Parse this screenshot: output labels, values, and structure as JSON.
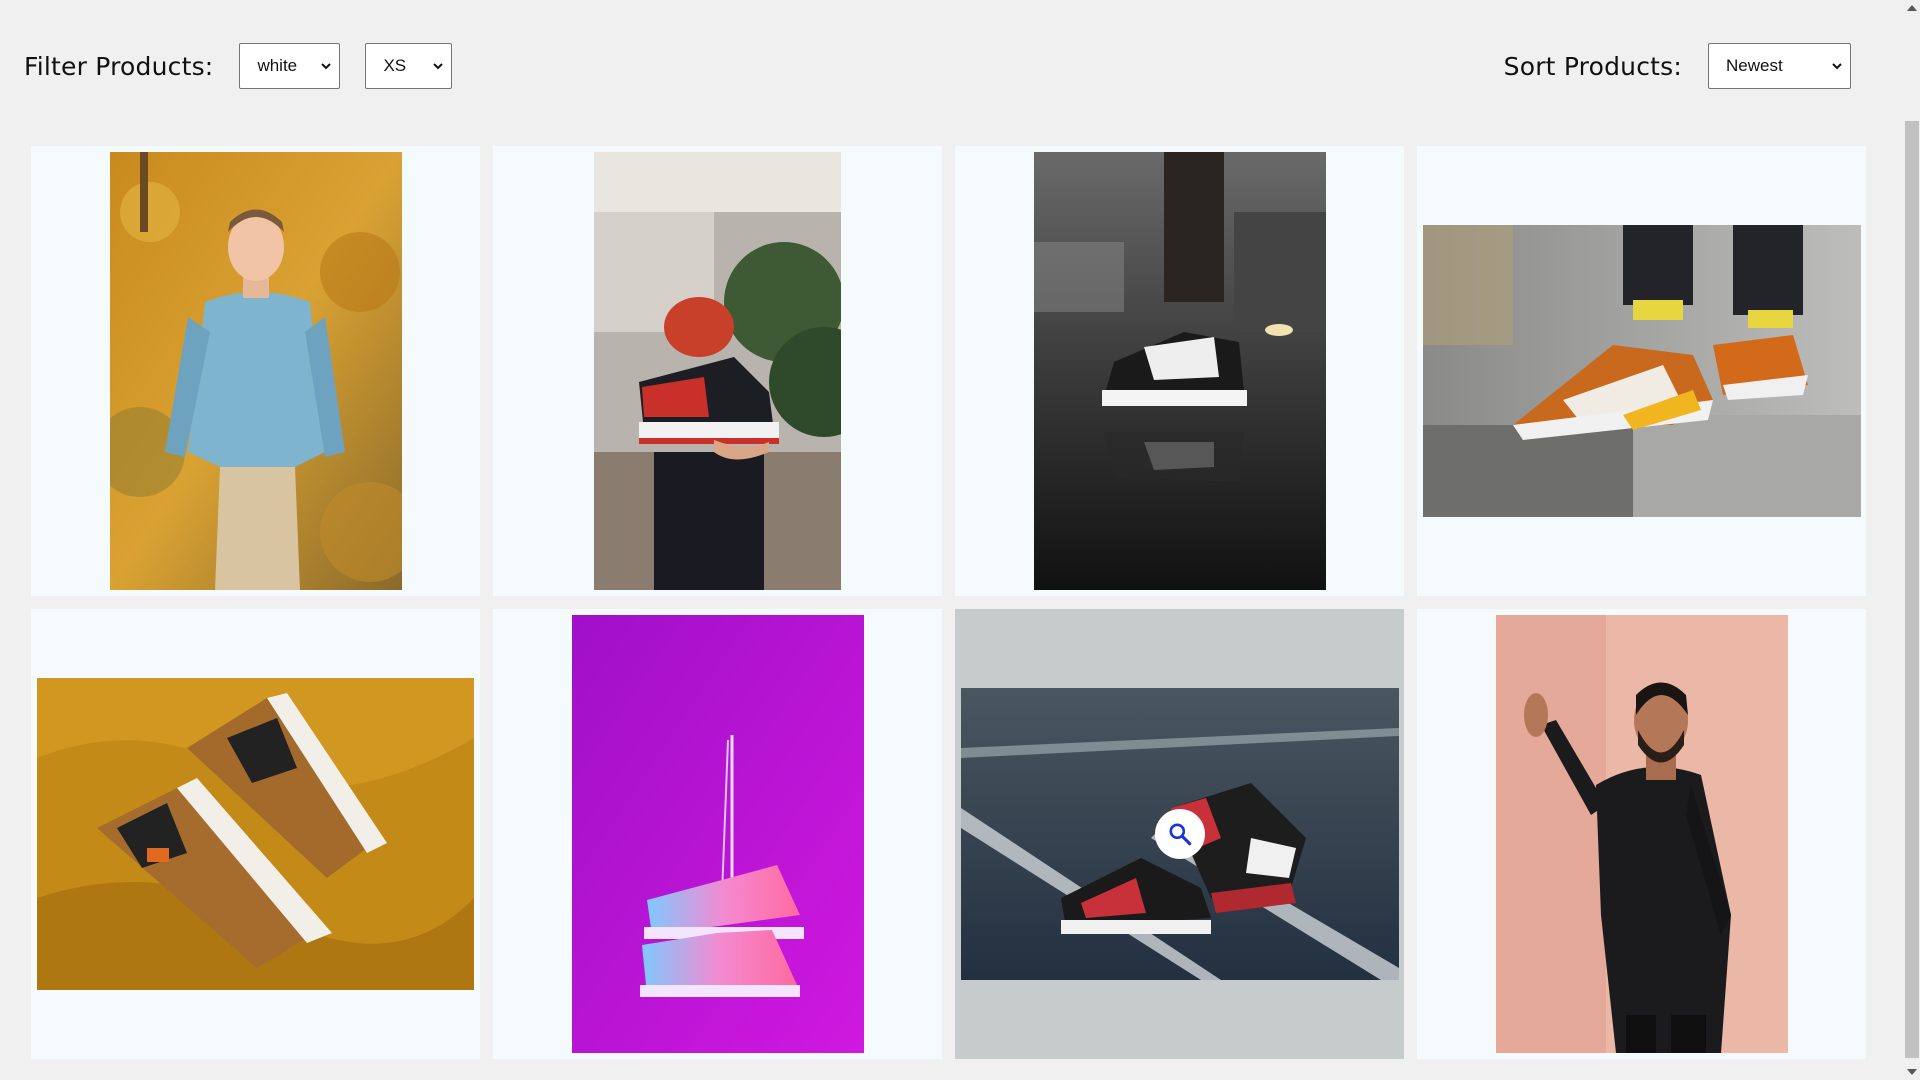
{
  "filter": {
    "title": "Filter Products:",
    "color_value": "white",
    "size_value": "XS"
  },
  "sort": {
    "title": "Sort Products:",
    "value": "Newest"
  },
  "products": [
    {
      "image": "man-blue-shirt-autumn-leaves"
    },
    {
      "image": "hand-holding-red-black-sneaker"
    },
    {
      "image": "black-white-sneaker-wet-street"
    },
    {
      "image": "orange-sneakers-on-curb"
    },
    {
      "image": "brown-sneakers-mustard-fabric"
    },
    {
      "image": "pink-sneakers-hanging-magenta"
    },
    {
      "image": "red-black-sneakers-court"
    },
    {
      "image": "man-black-coat-pink-wall"
    }
  ],
  "icons": {
    "dropdown": "chevron-down-icon",
    "hover": "search-icon"
  },
  "colors": {
    "page_bg": "#f0f0f0",
    "card_bg": "#f5fbfd",
    "card_hover_bg": "#c6cbcc",
    "search_icon": "#1a33e0"
  }
}
